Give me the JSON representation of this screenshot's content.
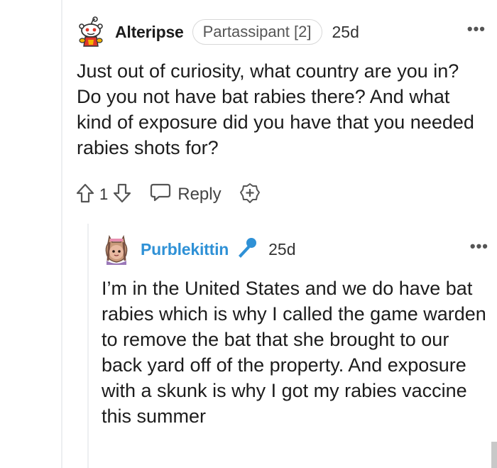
{
  "comments": [
    {
      "username": "Alteripse",
      "flair": "Partassipant [2]",
      "time": "25d",
      "more": "•••",
      "body": "Just out of curiosity, what country are you in? Do you not have bat rabies there? And what kind of exposure did you have that you needed rabies shots for?",
      "score": "1",
      "reply_label": "Reply"
    },
    {
      "username": "Purblekittin",
      "time": "25d",
      "more": "•••",
      "body": "I’m in the United States and we do have bat rabies which is why I called the game warden to remove the bat that she brought to our back yard off of the property. And exposure with a skunk is why I got my rabies vaccine this summer"
    }
  ],
  "colors": {
    "username_reply": "#2f91d6",
    "mic_icon": "#2f91d6",
    "text": "#1c1c1c",
    "thread_line": "#edeff1"
  },
  "icons": [
    "snoo-avatar-icon",
    "upvote-icon",
    "downvote-icon",
    "reply-bubble-icon",
    "award-plus-icon",
    "microphone-icon",
    "more-options-icon"
  ]
}
